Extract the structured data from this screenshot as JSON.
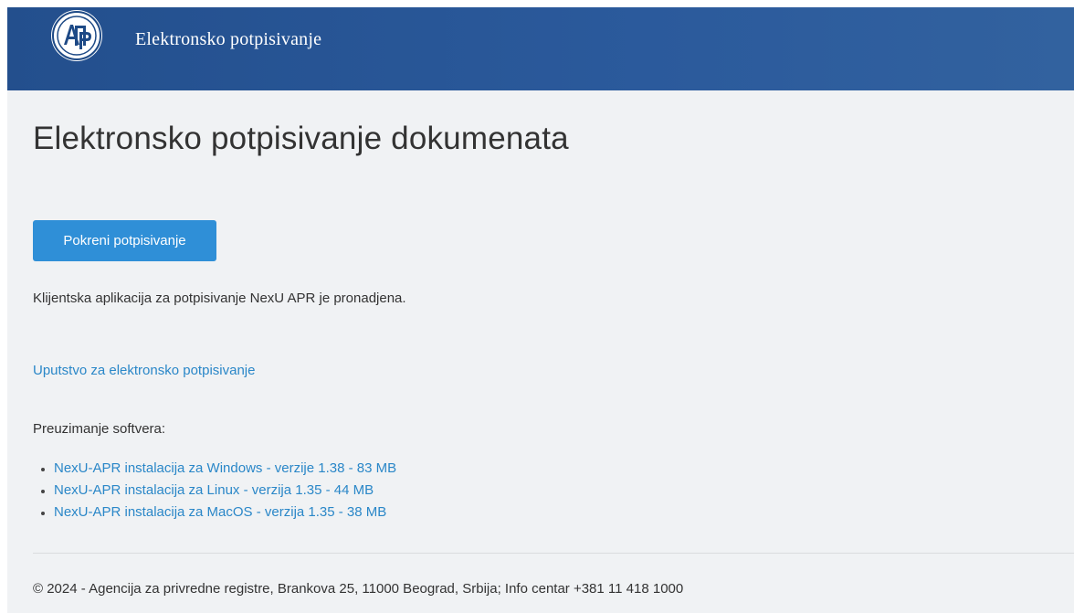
{
  "header": {
    "brand_title": "Elektronsko potpisivanje",
    "logo_letters": "АПР"
  },
  "main": {
    "page_title": "Elektronsko potpisivanje dokumenata",
    "start_button_label": "Pokreni potpisivanje",
    "status_text": "Klijentska aplikacija za potpisivanje NexU APR je pronadjena.",
    "guide_link_text": "Uputstvo za elektronsko potpisivanje",
    "downloads_label": "Preuzimanje softvera:",
    "downloads": [
      {
        "label": "NexU-APR instalacija za Windows - verzije 1.38 - 83 MB"
      },
      {
        "label": "NexU-APR instalacija za Linux - verzija 1.35 - 44 MB"
      },
      {
        "label": "NexU-APR instalacija za MacOS - verzija 1.35 - 38 MB"
      }
    ]
  },
  "footer": {
    "text": "© 2024 - Agencija za privredne registre, Brankova 25, 11000 Beograd, Srbija; Info centar +381 11 418 1000"
  },
  "colors": {
    "header_bg": "#2b5a9c",
    "main_bg": "#f0f2f4",
    "button_bg": "#2f8fd7",
    "link": "#2a87c8"
  }
}
